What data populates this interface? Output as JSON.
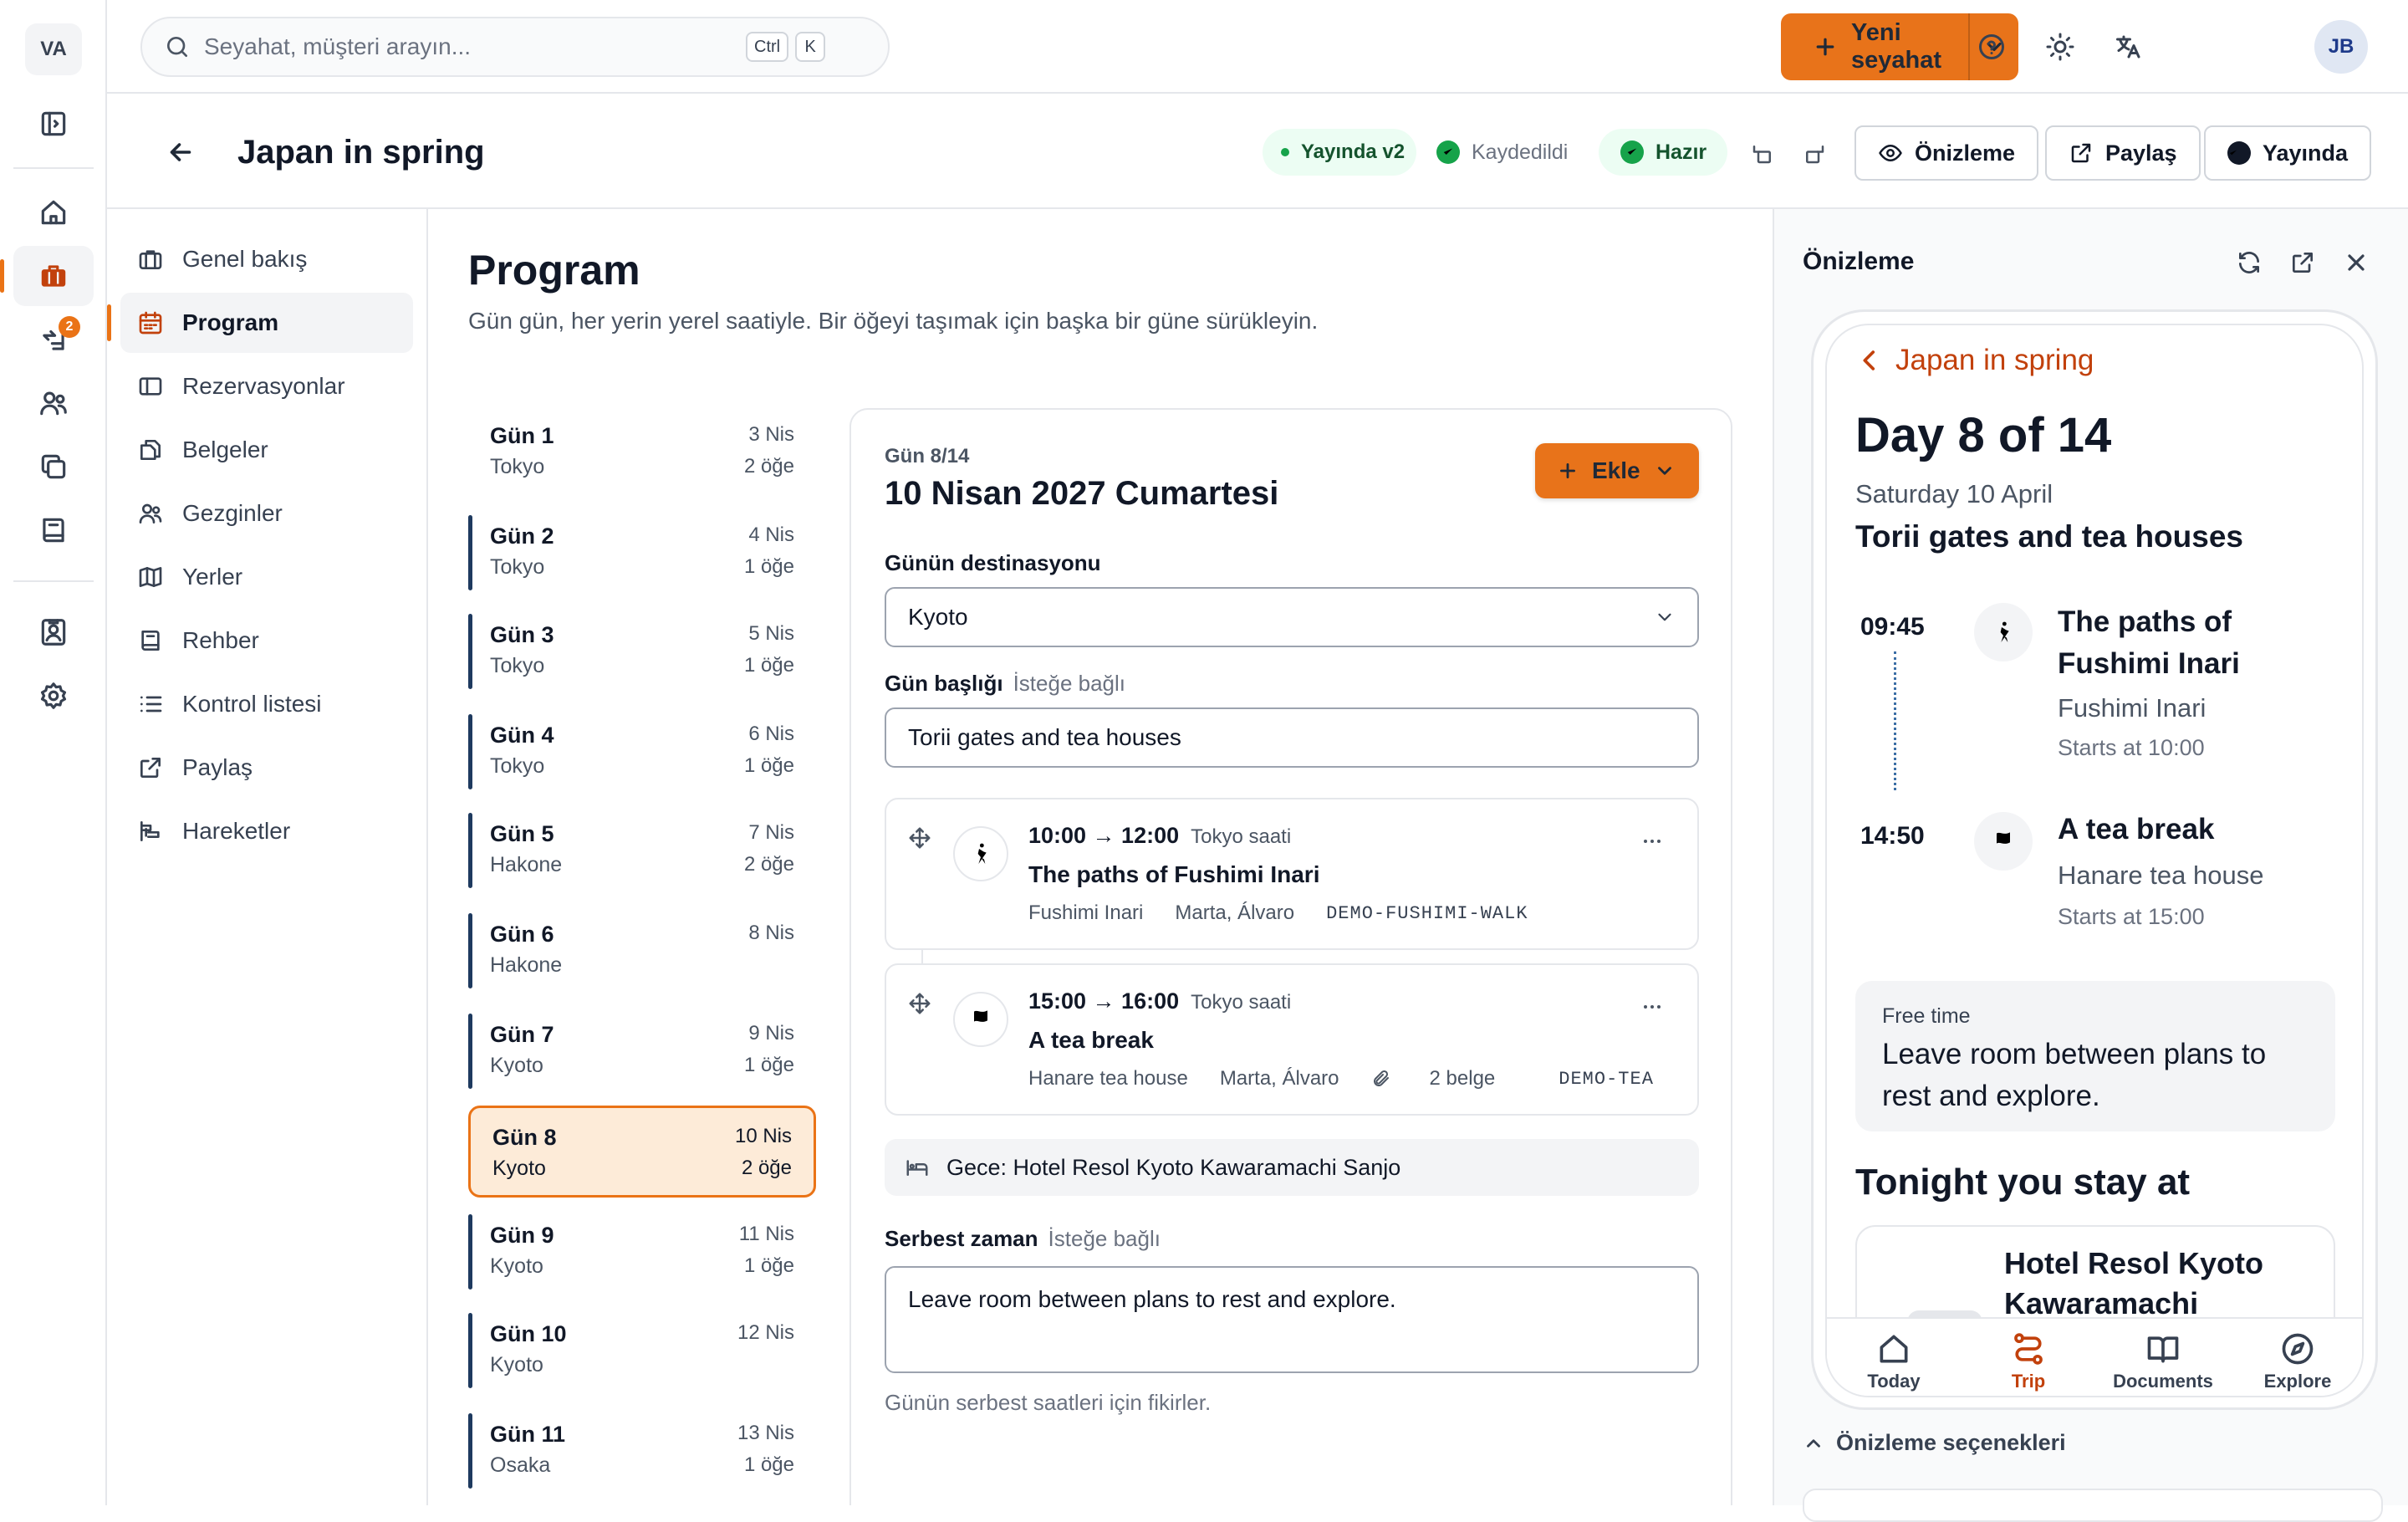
{
  "workspace": {
    "initials": "VA"
  },
  "rail": {
    "badge_count": "2"
  },
  "topbar": {
    "search_placeholder": "Seyahat, müşteri arayın...",
    "kbd_ctrl": "Ctrl",
    "kbd_k": "K",
    "new_trip_label": "Yeni seyahat",
    "user_initials": "JB"
  },
  "trip": {
    "title": "Japan in spring",
    "status_published": "Yayında v2",
    "status_saved": "Kaydedildi",
    "status_ready": "Hazır",
    "preview_label": "Önizleme",
    "share_label": "Paylaş",
    "publish_label": "Yayında"
  },
  "sections": [
    {
      "label": "Genel bakış",
      "icon": "briefcase-icon"
    },
    {
      "label": "Program",
      "icon": "calendar-icon"
    },
    {
      "label": "Rezervasyonlar",
      "icon": "ticket-icon"
    },
    {
      "label": "Belgeler",
      "icon": "documents-icon"
    },
    {
      "label": "Gezginler",
      "icon": "users-icon"
    },
    {
      "label": "Yerler",
      "icon": "map-icon"
    },
    {
      "label": "Rehber",
      "icon": "book-icon"
    },
    {
      "label": "Kontrol listesi",
      "icon": "list-icon"
    },
    {
      "label": "Paylaş",
      "icon": "share-icon"
    },
    {
      "label": "Hareketler",
      "icon": "activity-icon"
    }
  ],
  "program": {
    "title": "Program",
    "subtitle": "Gün gün, her yerin yerel saatiyle. Bir öğeyi taşımak için başka bir güne sürükleyin."
  },
  "days": [
    {
      "name": "Gün 1",
      "city": "Tokyo",
      "date": "3 Nis",
      "items": "2 öğe"
    },
    {
      "name": "Gün 2",
      "city": "Tokyo",
      "date": "4 Nis",
      "items": "1 öğe"
    },
    {
      "name": "Gün 3",
      "city": "Tokyo",
      "date": "5 Nis",
      "items": "1 öğe"
    },
    {
      "name": "Gün 4",
      "city": "Tokyo",
      "date": "6 Nis",
      "items": "1 öğe"
    },
    {
      "name": "Gün 5",
      "city": "Hakone",
      "date": "7 Nis",
      "items": "2 öğe"
    },
    {
      "name": "Gün 6",
      "city": "Hakone",
      "date": "8 Nis",
      "items": ""
    },
    {
      "name": "Gün 7",
      "city": "Kyoto",
      "date": "9 Nis",
      "items": "1 öğe"
    },
    {
      "name": "Gün 8",
      "city": "Kyoto",
      "date": "10 Nis",
      "items": "2 öğe"
    },
    {
      "name": "Gün 9",
      "city": "Kyoto",
      "date": "11 Nis",
      "items": "1 öğe"
    },
    {
      "name": "Gün 10",
      "city": "Kyoto",
      "date": "12 Nis",
      "items": ""
    },
    {
      "name": "Gün 11",
      "city": "Osaka",
      "date": "13 Nis",
      "items": "1 öğe"
    }
  ],
  "day_detail": {
    "day_label": "Gün 8/14",
    "date_title": "10 Nisan 2027 Cumartesi",
    "add_label": "Ekle",
    "destination_label": "Günün destinasyonu",
    "destination_value": "Kyoto",
    "day_title_label": "Gün başlığı",
    "optional_label": "İsteğe bağlı",
    "day_title_value": "Torii gates and tea houses",
    "items": [
      {
        "time": "10:00 → 12:00",
        "tz": "Tokyo saati",
        "name": "The paths of Fushimi Inari",
        "place": "Fushimi Inari",
        "travellers": "Marta, Álvaro",
        "docs": "",
        "code": "DEMO-FUSHIMI-WALK",
        "icon": "walking-icon"
      },
      {
        "time": "15:00 → 16:00",
        "tz": "Tokyo saati",
        "name": "A tea break",
        "place": "Hanare tea house",
        "travellers": "Marta, Álvaro",
        "docs": "2 belge",
        "code": "DEMO-TEA",
        "icon": "flag-icon"
      }
    ],
    "overnight": "Gece: Hotel Resol Kyoto Kawaramachi Sanjo",
    "free_time_label": "Serbest zaman",
    "free_time_optional": "İsteğe bağlı",
    "free_time_value": "Leave room between plans to rest and explore.",
    "free_time_help": "Günün serbest saatleri için fikirler."
  },
  "preview": {
    "title": "Önizleme",
    "options_label": "Önizleme seçenekleri",
    "phone": {
      "back_label": "Japan in spring",
      "day_heading": "Day 8 of 14",
      "date": "Saturday 10 April",
      "title": "Torii gates and tea houses",
      "items": [
        {
          "time": "09:45",
          "name": "The paths of Fushimi Inari",
          "place": "Fushimi Inari",
          "starts": "Starts at 10:00"
        },
        {
          "time": "14:50",
          "name": "A tea break",
          "place": "Hanare tea house",
          "starts": "Starts at 15:00"
        }
      ],
      "free_label": "Free time",
      "free_text": "Leave room between plans to rest and explore.",
      "tonight": "Tonight you stay at",
      "hotel": "Hotel Resol Kyoto Kawaramachi",
      "tabs": [
        "Today",
        "Trip",
        "Documents",
        "Explore"
      ]
    }
  },
  "colors": {
    "accent": "#e8731a",
    "success": "#16a34a",
    "selected_bg": "#fdebd8"
  }
}
